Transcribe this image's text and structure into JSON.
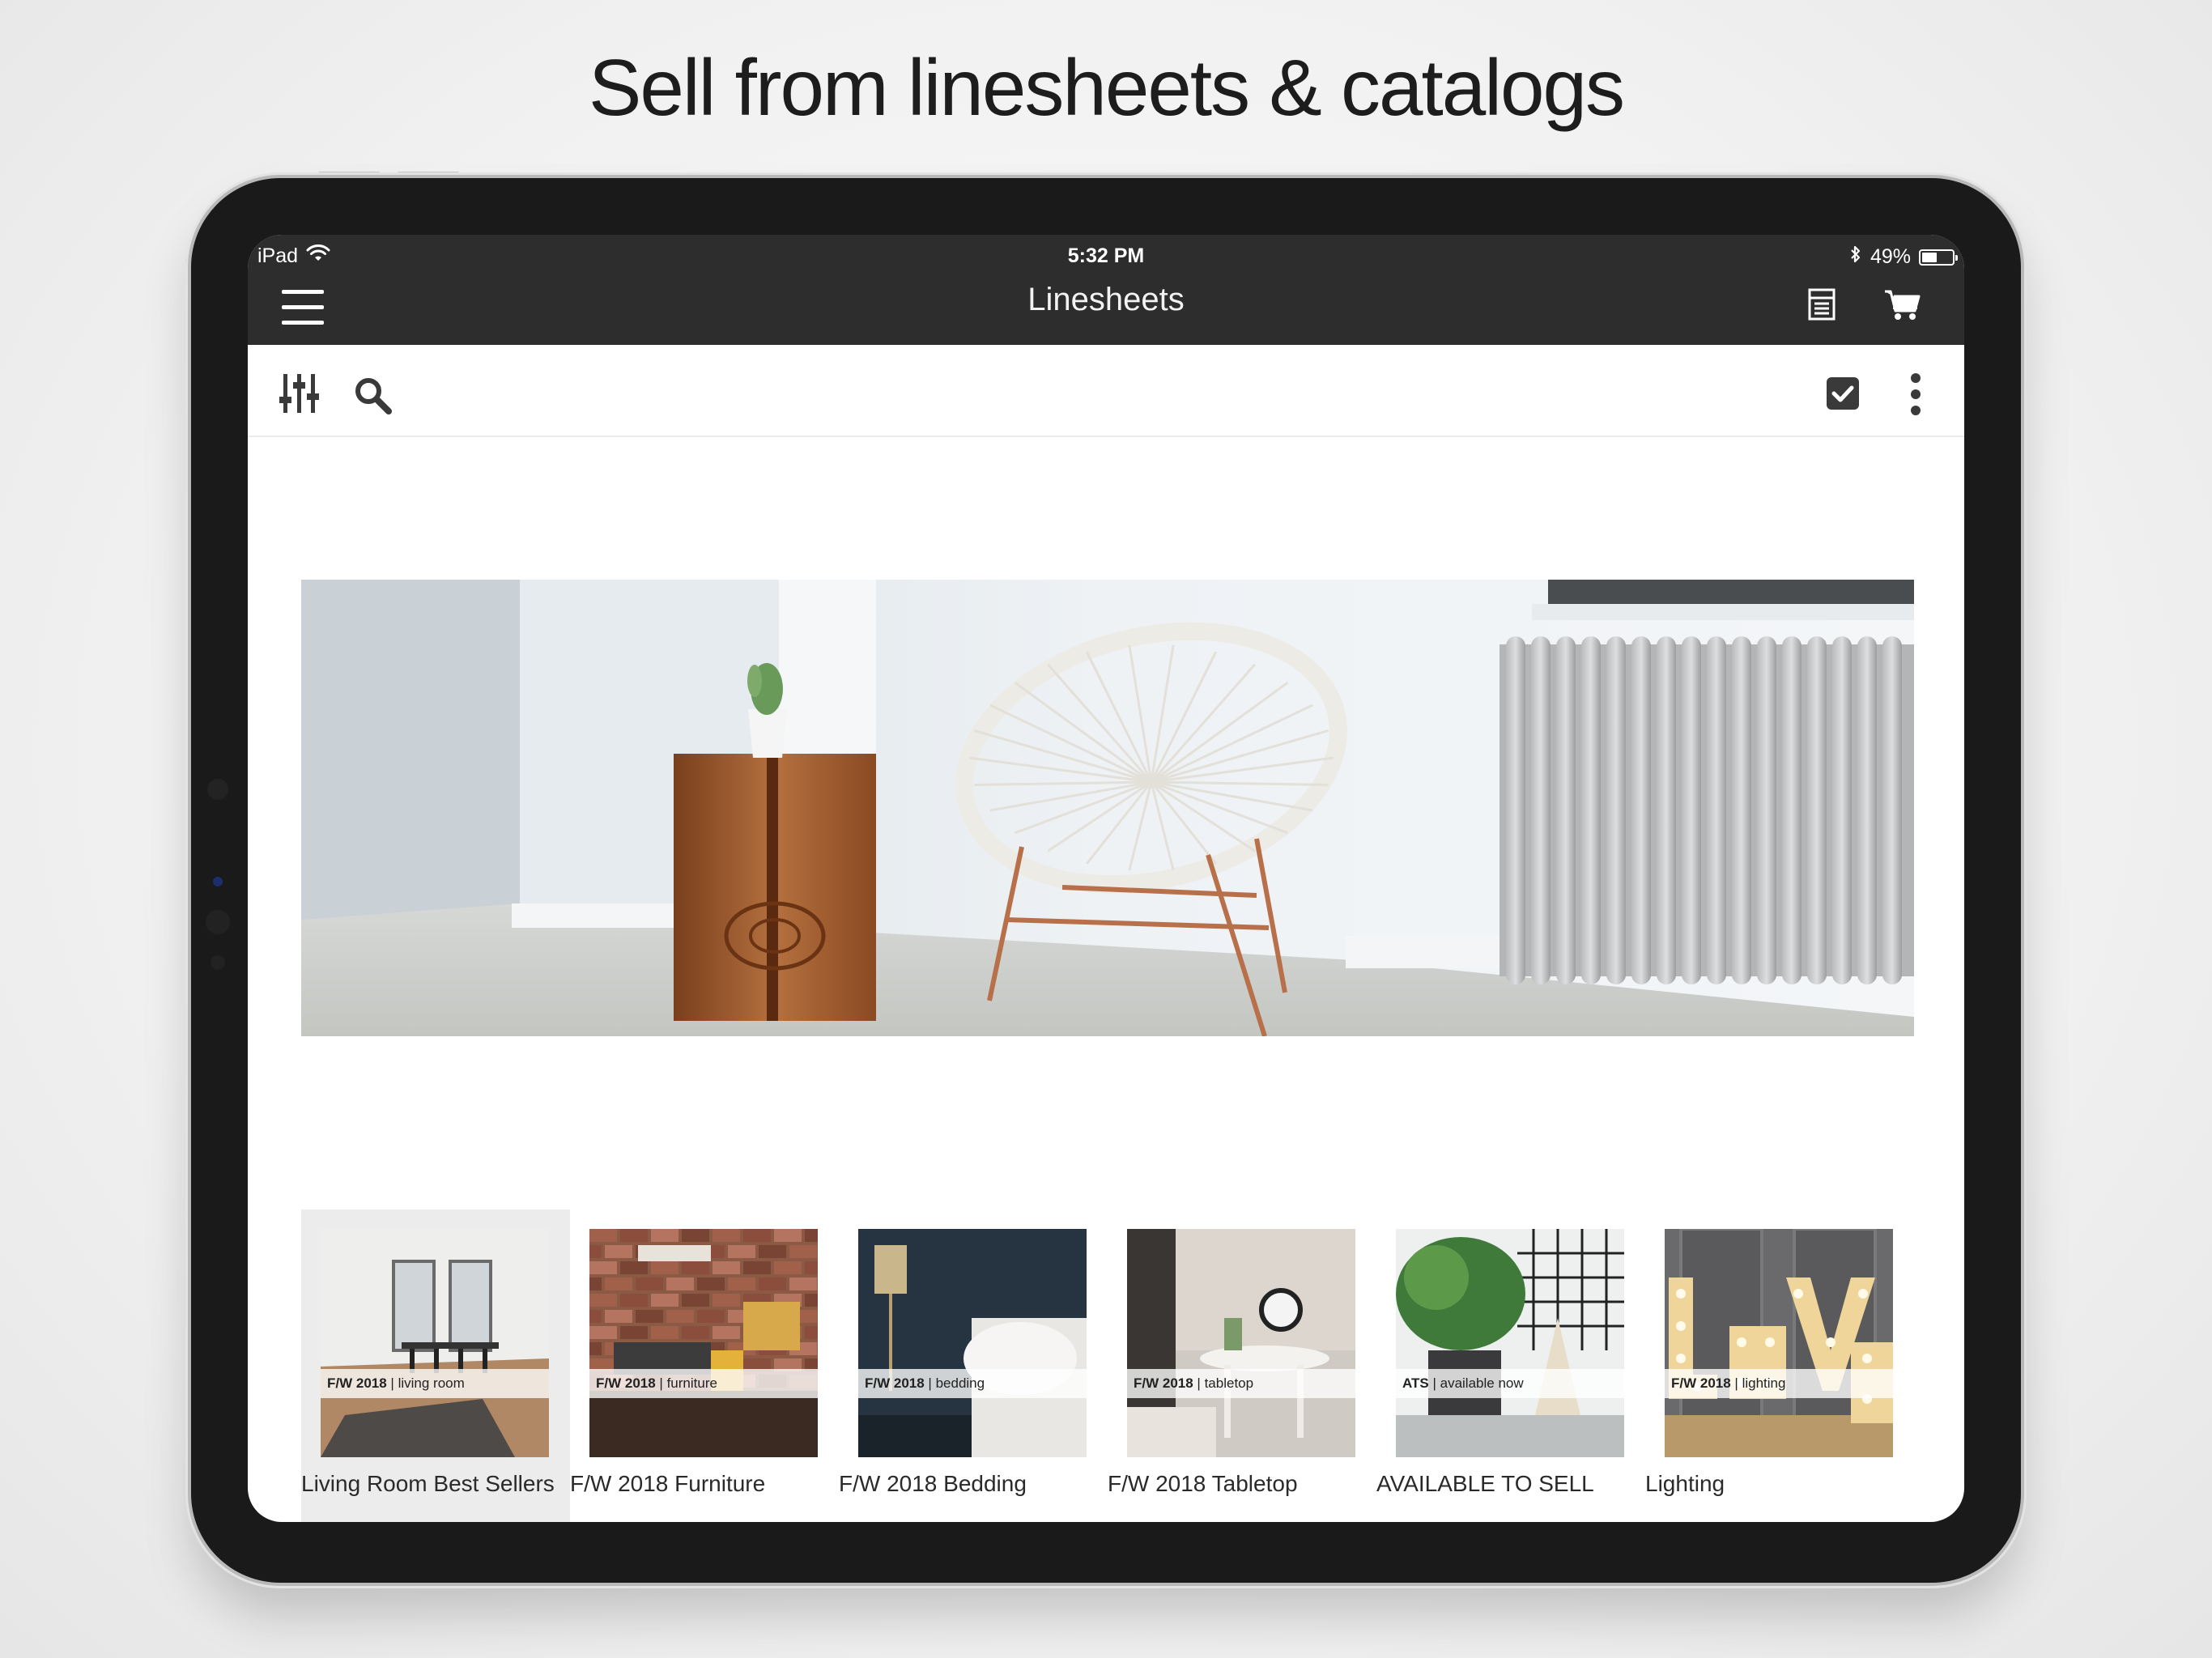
{
  "headline": "Sell from linesheets & catalogs",
  "status_bar": {
    "device": "iPad",
    "time": "5:32 PM",
    "battery_percent": "49%",
    "battery_level": 0.49
  },
  "nav": {
    "title": "Linesheets"
  },
  "icons": {
    "menu": "hamburger-menu-icon",
    "list": "list-document-icon",
    "cart": "shopping-cart-icon",
    "filter": "filter-sliders-icon",
    "search": "search-icon",
    "select": "checkbox-checked-icon",
    "more": "more-vertical-icon"
  },
  "colors": {
    "bar": "#2d2d2d",
    "icon": "#3a3a3a",
    "selected_card": "#ececec"
  },
  "linesheets": [
    {
      "label": "Living Room Best Sellers",
      "tag_bold": "F/W 2018",
      "tag_sep": " | ",
      "tag_text": "living room",
      "selected": true
    },
    {
      "label": "F/W 2018 Furniture",
      "tag_bold": "F/W 2018",
      "tag_sep": " | ",
      "tag_text": "furniture",
      "selected": false
    },
    {
      "label": "F/W 2018 Bedding",
      "tag_bold": "F/W 2018",
      "tag_sep": " | ",
      "tag_text": "bedding",
      "selected": false
    },
    {
      "label": "F/W 2018 Tabletop",
      "tag_bold": "F/W 2018",
      "tag_sep": " | ",
      "tag_text": "tabletop",
      "selected": false
    },
    {
      "label": "AVAILABLE TO SELL",
      "tag_bold": "ATS",
      "tag_sep": " | ",
      "tag_text": "available now",
      "selected": false
    },
    {
      "label": "Lighting",
      "tag_bold": "F/W 2018",
      "tag_sep": " | ",
      "tag_text": "lighting",
      "selected": false
    }
  ]
}
